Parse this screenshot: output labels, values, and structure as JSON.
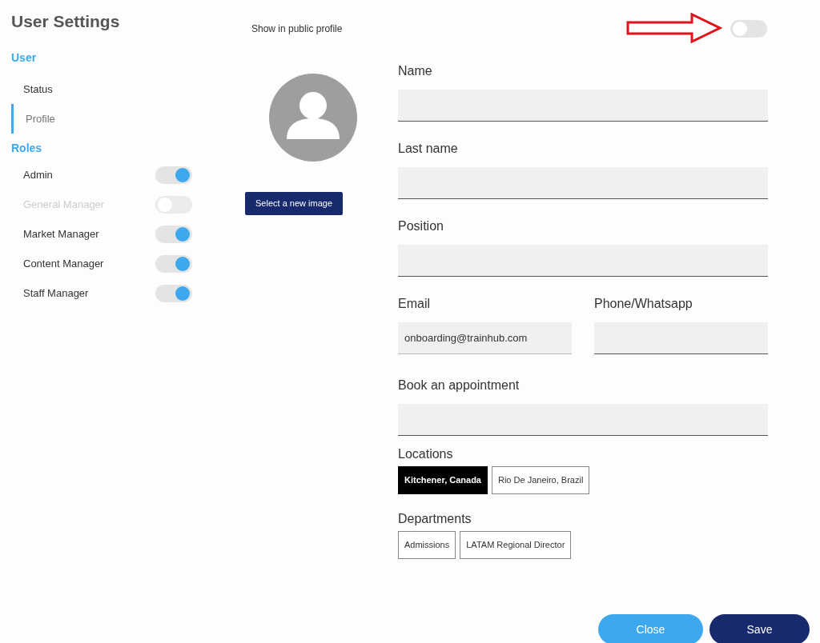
{
  "title": "User Settings",
  "sidebar": {
    "sections": [
      {
        "heading": "User",
        "items": [
          {
            "label": "Status",
            "selected": false
          },
          {
            "label": "Profile",
            "selected": true
          }
        ]
      }
    ]
  },
  "roles": {
    "heading": "Roles",
    "items": [
      {
        "label": "Admin",
        "on": true,
        "disabled": false
      },
      {
        "label": "General Manager",
        "on": false,
        "disabled": true
      },
      {
        "label": "Market Manager",
        "on": true,
        "disabled": false
      },
      {
        "label": "Content Manager",
        "on": true,
        "disabled": false
      },
      {
        "label": "Staff Manager",
        "on": true,
        "disabled": false
      }
    ]
  },
  "public_profile": {
    "label": "Show in public profile",
    "on": false
  },
  "avatar_button": "Select a new image",
  "form": {
    "fields": [
      {
        "label": "Name"
      },
      {
        "label": "Last name"
      },
      {
        "label": "Position"
      }
    ],
    "row": [
      {
        "label": "Email",
        "value": "onboarding@trainhub.com"
      },
      {
        "label": "Phone/Whatsapp"
      }
    ],
    "appointment": {
      "label": "Book an appointment"
    },
    "locations": {
      "label": "Locations",
      "items": [
        {
          "label": "Kitchener, Canada",
          "selected": true
        },
        {
          "label": "Rio De Janeiro, Brazil",
          "selected": false
        }
      ]
    },
    "departments": {
      "label": "Departments",
      "items": [
        {
          "label": "Admissions",
          "selected": false
        },
        {
          "label": "LATAM Regional Director",
          "selected": false
        }
      ]
    }
  },
  "buttons": [
    {
      "label": "Close",
      "kind": "secondary"
    },
    {
      "label": "Save",
      "kind": "primary"
    }
  ]
}
